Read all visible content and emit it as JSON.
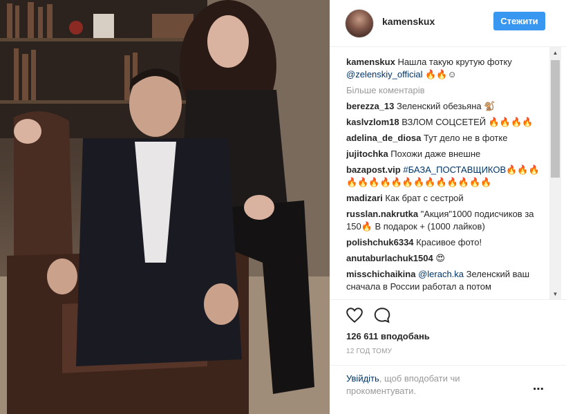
{
  "post": {
    "username": "kamenskux",
    "follow_label": "Стежити"
  },
  "caption": {
    "username": "kamenskux",
    "text": " Нашла такую крутую фотку ",
    "mention": "@zelenskiy_official",
    "emoji": " 🔥🔥☺"
  },
  "more_comments": "Більше коментарів",
  "comments": [
    {
      "user": "berezza_13",
      "text": " Зеленский обезьяна 🐒"
    },
    {
      "user": "kaslvzlom18",
      "text": " ВЗЛОМ СОЦСЕТЕЙ 🔥🔥🔥🔥"
    },
    {
      "user": "adelina_de_diosa",
      "text": " Тут дело не в фотке"
    },
    {
      "user": "jujitochka",
      "text": " Похожи даже внешне"
    },
    {
      "user": "bazapost.vip",
      "text": "",
      "link": " #БАЗА_ПОСТАВЩИКОВ🔥🔥🔥 🔥🔥🔥🔥🔥🔥🔥🔥🔥🔥🔥🔥🔥"
    },
    {
      "user": "madizari",
      "text": " Как брат с сестрой"
    },
    {
      "user": "russlan.nakrutka",
      "text": " \"Акция\"1000 подисчиков за 150🔥 В подарок + (1000 лайков)"
    },
    {
      "user": "polishchuk6334",
      "text": " Красивое фото!"
    },
    {
      "user": "anutaburlachuk1504",
      "text": " 😍"
    },
    {
      "user": "misschichaikina",
      "text": " Зеленский ваш сначала в России работал а потом",
      "mention": " @lerach.ka"
    }
  ],
  "likes": "126 611 вподобань",
  "time": "12 ГОД ТОМУ",
  "footer": {
    "login_link": "Увійдіть",
    "login_text": ", щоб вподобати чи прокоментувати.",
    "more_icon": "⋯"
  },
  "icons": {
    "heart": "heart-icon",
    "comment": "comment-icon",
    "more": "more-options-icon"
  },
  "colors": {
    "accent": "#3897f0",
    "link": "#003569",
    "muted": "#999999"
  }
}
